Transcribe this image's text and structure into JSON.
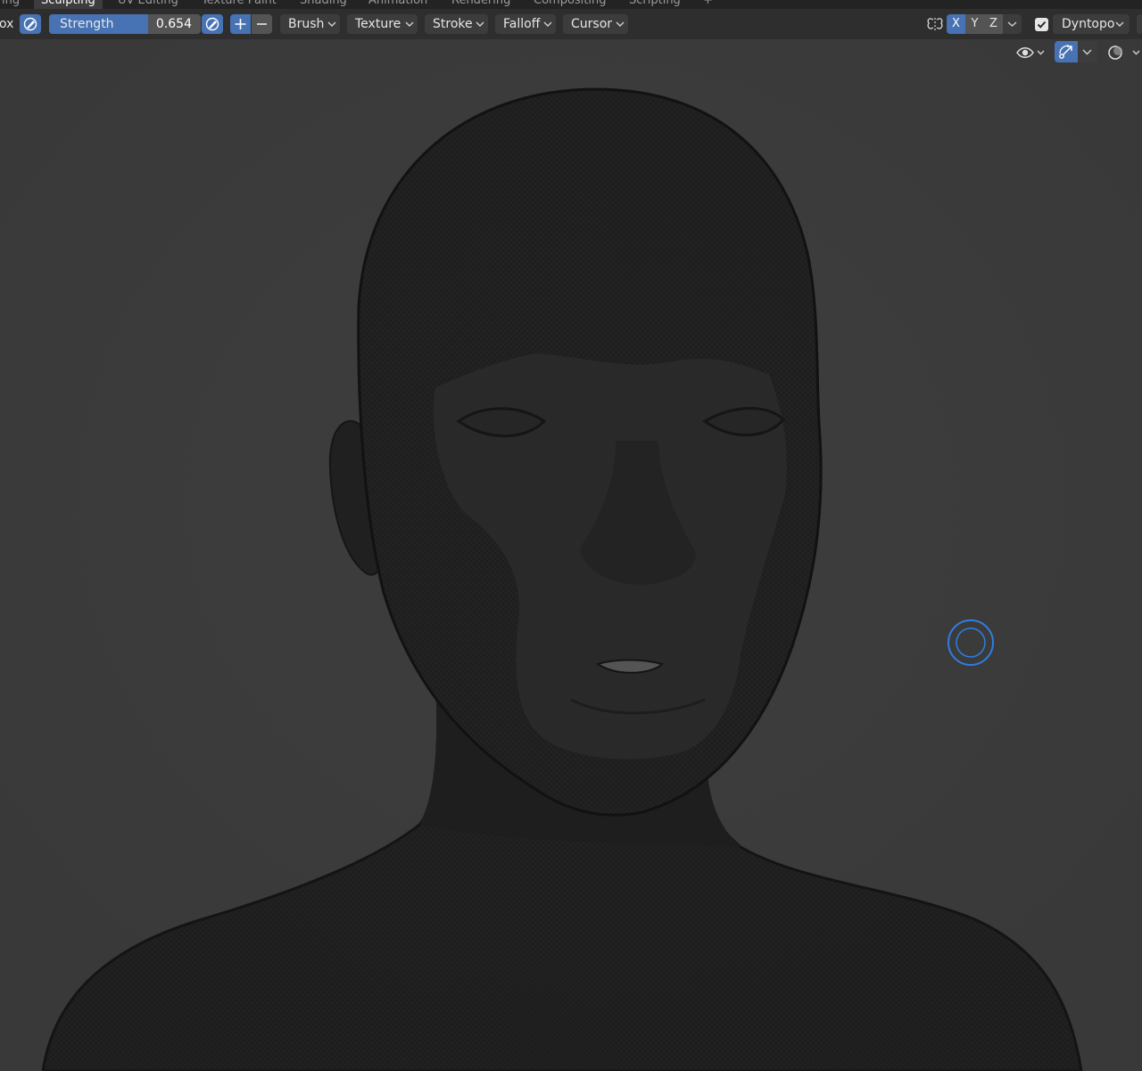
{
  "workspace_tabs": [
    {
      "label": "ing",
      "active": false
    },
    {
      "label": "Sculpting",
      "active": true
    },
    {
      "label": "UV Editing",
      "active": false
    },
    {
      "label": "Texture Paint",
      "active": false
    },
    {
      "label": "Shading",
      "active": false
    },
    {
      "label": "Animation",
      "active": false
    },
    {
      "label": "Rendering",
      "active": false
    },
    {
      "label": "Compositing",
      "active": false
    },
    {
      "label": "Scripting",
      "active": false
    },
    {
      "label": "+",
      "active": false
    }
  ],
  "tool_header": {
    "left_fragment": "ox",
    "strength": {
      "label": "Strength",
      "value_text": "0.654",
      "value": 0.654
    },
    "menus": {
      "brush": "Brush",
      "texture": "Texture",
      "stroke": "Stroke",
      "falloff": "Falloff",
      "cursor": "Cursor"
    },
    "symmetry": {
      "x": "X",
      "y": "Y",
      "z": "Z",
      "x_enabled": true
    },
    "dyntopo": {
      "label": "Dyntopo",
      "checked": true
    }
  },
  "colors": {
    "accent": "#4772b3",
    "header_bg": "#2e2e2e",
    "viewport_bg": "#3d3d3d",
    "mesh": "#1c1c1c",
    "brush_cursor": "#2f7de1"
  },
  "icons": {
    "strength_pressure": "pen-pressure-icon",
    "radius_pressure": "pen-pressure-icon",
    "symmetry": "symmetry-butterfly-icon",
    "visibility": "eye-icon",
    "gizmo": "gizmo-icon",
    "overlays": "overlay-circles-icon"
  }
}
